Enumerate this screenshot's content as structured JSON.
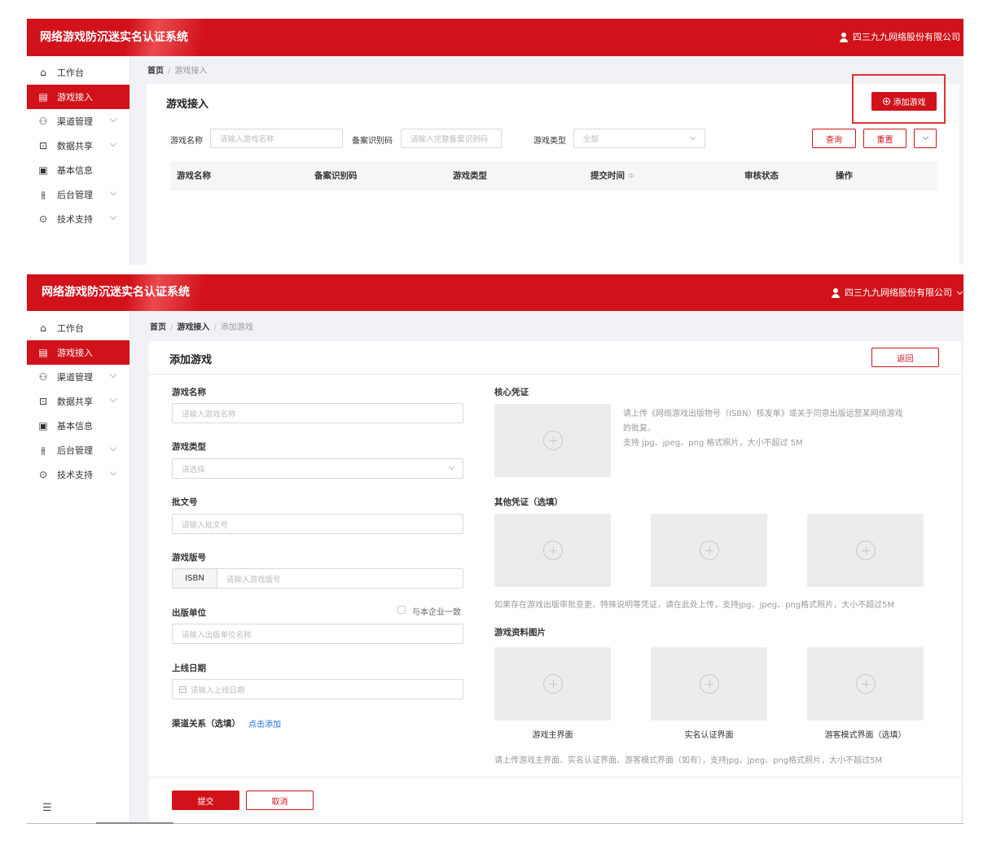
{
  "app": {
    "title": "网络游戏防沉迷实名认证系统",
    "company": "四三九九网络股份有限公司"
  },
  "sidebar": {
    "items": [
      {
        "label": "工作台",
        "icon": "home-icon"
      },
      {
        "label": "游戏接入",
        "icon": "game-icon"
      },
      {
        "label": "渠道管理",
        "icon": "channel-icon"
      },
      {
        "label": "数据共享",
        "icon": "share-icon"
      },
      {
        "label": "基本信息",
        "icon": "info-icon"
      },
      {
        "label": "后台管理",
        "icon": "admin-icon"
      },
      {
        "label": "技术支持",
        "icon": "support-icon"
      }
    ]
  },
  "list_page": {
    "breadcrumb": {
      "home": "首页",
      "current": "游戏接入"
    },
    "title": "游戏接入",
    "add_button": "添加游戏",
    "filters": {
      "name_label": "游戏名称",
      "name_placeholder": "请输入游戏名称",
      "code_label": "备案识别码",
      "code_placeholder": "请输入完整备案识别码",
      "type_label": "游戏类型",
      "type_value": "全部",
      "query_button": "查询",
      "reset_button": "重置"
    },
    "table_headers": [
      "游戏名称",
      "备案识别码",
      "游戏类型",
      "提交时间",
      "审核状态",
      "操作"
    ],
    "sort_glyph": "≑"
  },
  "form_page": {
    "breadcrumb": {
      "home": "首页",
      "parent": "游戏接入",
      "current": "添加游戏"
    },
    "title": "添加游戏",
    "back_button": "返回",
    "fields": {
      "game_name": {
        "label": "游戏名称",
        "placeholder": "请输入游戏名称"
      },
      "game_type": {
        "label": "游戏类型",
        "placeholder": "请选择"
      },
      "approval_no": {
        "label": "批文号",
        "placeholder": "请输入批文号"
      },
      "version_no": {
        "label": "游戏版号",
        "prefix": "ISBN",
        "placeholder": "请输入游戏版号"
      },
      "publisher": {
        "label": "出版单位",
        "checkbox_label": "与本企业一致",
        "placeholder": "请输入出版单位名称"
      },
      "launch_date": {
        "label": "上线日期",
        "placeholder": "请输入上线日期"
      },
      "channel": {
        "label": "渠道关系（选填）",
        "link": "点击添加"
      }
    },
    "core_credential": {
      "label": "核心凭证",
      "note_line1": "请上传《网络游戏出版物号（ISBN）核发单》或关于同意出版运营某网络游戏",
      "note_line2": "的批复。",
      "note_line3": "支持 jpg、jpeg、png 格式照片，大小不超过 5M"
    },
    "other_credential": {
      "label": "其他凭证（选填）",
      "note": "如果存在游戏出版审批变更、特殊说明等凭证，请在此处上传，支持jpg、jpeg、png格式照片，大小不超过5M"
    },
    "game_images": {
      "label": "游戏资料图片",
      "captions": [
        "游戏主界面",
        "实名认证界面",
        "游客模式界面（选填）"
      ],
      "note": "请上传游戏主界面、实名认证界面、游客模式界面（如有），支持jpg、jpeg、png格式照片，大小不超过5M"
    },
    "submit_button": "提交",
    "cancel_button": "取消"
  }
}
